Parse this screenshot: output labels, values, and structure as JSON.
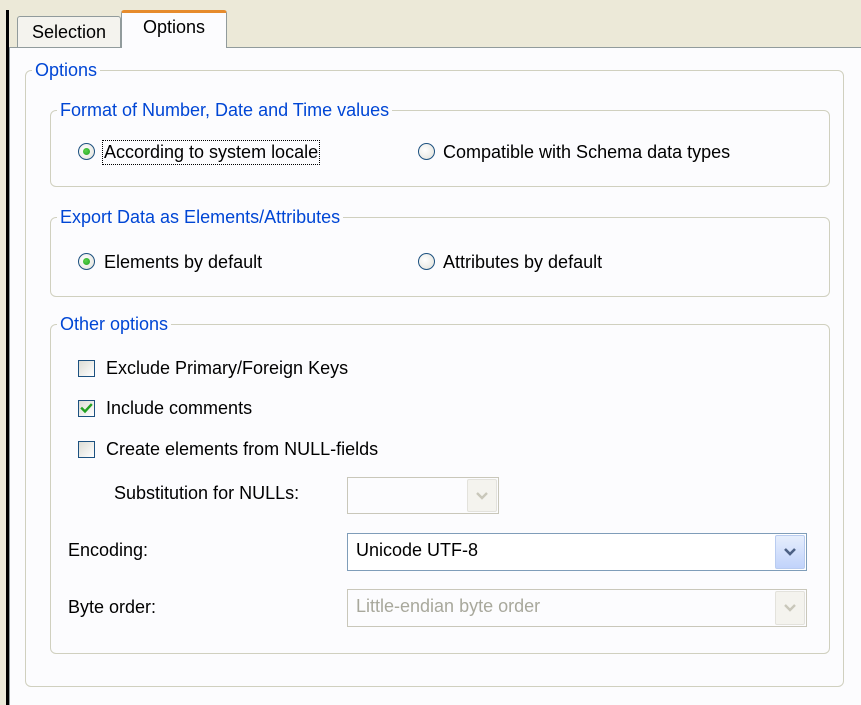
{
  "tabs": [
    {
      "label": "Selection",
      "selected": false
    },
    {
      "label": "Options",
      "selected": true
    }
  ],
  "options_group": {
    "legend": "Options",
    "format_group": {
      "legend": "Format of Number, Date and Time values",
      "radio_locale": {
        "label": "According to system locale",
        "checked": true
      },
      "radio_schema": {
        "label": "Compatible with Schema data types",
        "checked": false
      }
    },
    "export_group": {
      "legend": "Export Data as Elements/Attributes",
      "radio_elements": {
        "label": "Elements by default",
        "checked": true
      },
      "radio_attributes": {
        "label": "Attributes by default",
        "checked": false
      }
    },
    "other_group": {
      "legend": "Other options",
      "exclude_keys": {
        "label": "Exclude Primary/Foreign Keys",
        "checked": false
      },
      "include_comments": {
        "label": "Include comments",
        "checked": true
      },
      "create_null_elements": {
        "label": "Create elements from NULL-fields",
        "checked": false
      },
      "substitution": {
        "label": "Substitution for NULLs:",
        "value": "",
        "enabled": false
      },
      "encoding": {
        "label": "Encoding:",
        "value": "Unicode UTF-8",
        "enabled": true
      },
      "byte_order": {
        "label": "Byte order:",
        "value": "Little-endian byte order",
        "enabled": false
      }
    }
  },
  "colors": {
    "group_legend": "#0046d5",
    "tab_highlight": "#e68b2c",
    "radio_dot": "#21a121",
    "check_mark": "#21a121"
  },
  "icons": {
    "dropdown": "chevron-down-icon",
    "check": "checkmark-icon"
  }
}
